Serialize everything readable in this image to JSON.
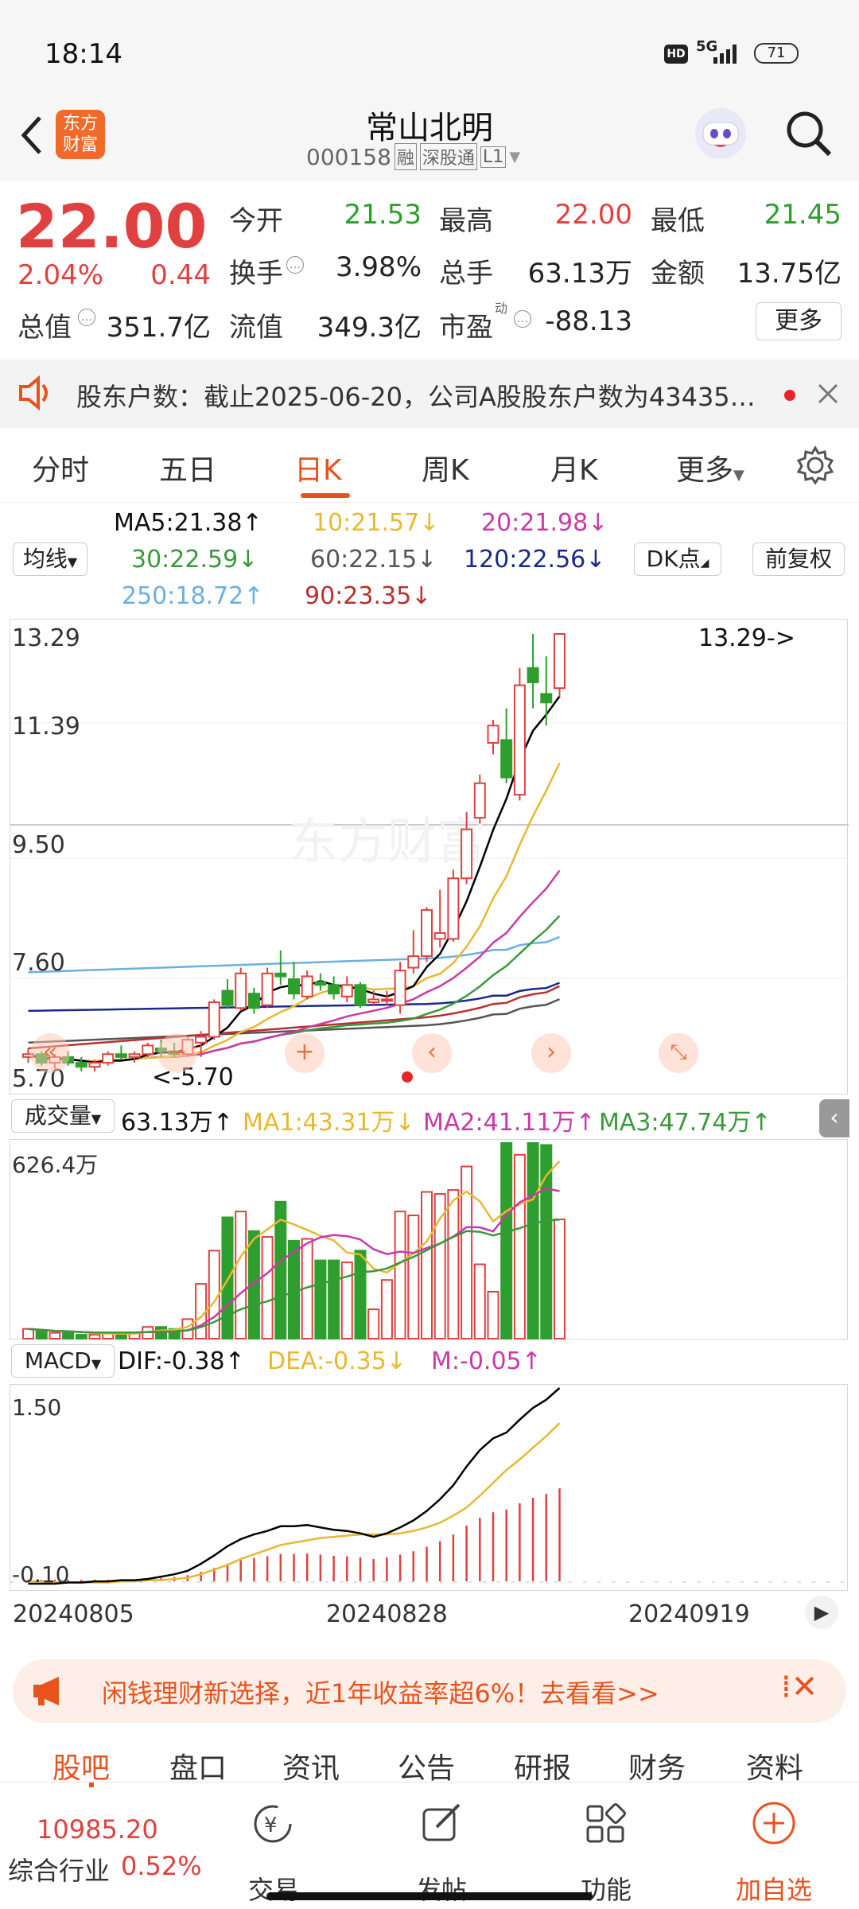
{
  "status": {
    "time": "18:14",
    "battery": "71",
    "network": "5G",
    "hd": "HD"
  },
  "nav": {
    "logo_line1": "东方",
    "logo_line2": "财富",
    "title": "常山北明",
    "code": "000158",
    "tag1": "融",
    "tag2": "深股通",
    "tag3": "L1"
  },
  "quote": {
    "price": "22.00",
    "pct": "2.04%",
    "change": "0.44",
    "rows": [
      [
        {
          "label": "今开",
          "value": "21.53",
          "color": "green"
        },
        {
          "label": "最高",
          "value": "22.00",
          "color": "red"
        },
        {
          "label": "最低",
          "value": "21.45",
          "color": "green"
        }
      ],
      [
        {
          "label": "换手",
          "value": "3.98%",
          "color": "dark"
        },
        {
          "label": "总手",
          "value": "63.13万",
          "color": "dark"
        },
        {
          "label": "金额",
          "value": "13.75亿",
          "color": "dark"
        }
      ],
      [
        {
          "label": "总值",
          "value": "351.7亿",
          "color": "dark"
        },
        {
          "label": "流值",
          "value": "349.3亿",
          "color": "dark"
        },
        {
          "label": "市盈",
          "value": "-88.13",
          "color": "dark"
        }
      ]
    ],
    "pe_sup": "动",
    "more_label": "更多"
  },
  "notice": {
    "text": "股东户数：截止2025-06-20，公司A股股东户数为43435…"
  },
  "tabs": [
    {
      "label": "分时",
      "active": false
    },
    {
      "label": "五日",
      "active": false
    },
    {
      "label": "日K",
      "active": true
    },
    {
      "label": "周K",
      "active": false
    },
    {
      "label": "月K",
      "active": false
    },
    {
      "label": "更多",
      "active": false
    }
  ],
  "ma_panel": {
    "selector": "均线",
    "ma5": "MA5:21.38↑",
    "ma10": "10:21.57↓",
    "ma20": "20:21.98↓",
    "ma30": "30:22.59↓",
    "ma60": "60:22.15↓",
    "ma120": "120:22.56↓",
    "ma250": "250:18.72↑",
    "ma90": "90:23.35↓",
    "dk_label": "DK点",
    "adjust_label": "前复权"
  },
  "colors": {
    "up": "#e04040",
    "down": "#2e9e2e",
    "ma5": "#000000",
    "ma10": "#e8b830",
    "ma20": "#c83aa8",
    "ma30": "#3a9a3a",
    "ma60": "#555555",
    "ma120": "#1a2a8a",
    "ma250": "#6ab0e0",
    "ma90": "#b83030"
  },
  "price_chart": {
    "y_labels": [
      "13.29",
      "11.39",
      "9.50",
      "7.60",
      "5.70"
    ],
    "high_marker": "13.29->",
    "low_marker": "<-5.70",
    "watermark": "东方财富"
  },
  "volume_panel": {
    "selector": "成交量",
    "value": "63.13万↑",
    "ma1": "MA1:43.31万↓",
    "ma2": "MA2:41.11万↑",
    "ma3": "MA3:47.74万↑",
    "max_label": "626.4万"
  },
  "macd_panel": {
    "selector": "MACD",
    "dif": "DIF:-0.38↑",
    "dea": "DEA:-0.35↓",
    "m": "M:-0.05↑",
    "top_label": "1.50",
    "bottom_label": "-0.10"
  },
  "dates": [
    "20240805",
    "20240828",
    "20240919"
  ],
  "ad": {
    "text": "闲钱理财新选择，近1年收益率超6%！去看看>>"
  },
  "bottom_tabs": [
    "股吧",
    "盘口",
    "资讯",
    "公告",
    "研报",
    "财务",
    "资料"
  ],
  "footer": {
    "index_value": "10985.20",
    "index_label": "综合行业",
    "index_pct": "0.52%",
    "items": [
      {
        "label": "交易"
      },
      {
        "label": "发帖"
      },
      {
        "label": "功能"
      },
      {
        "label": "加自选"
      }
    ]
  },
  "candles": [
    [
      5.95,
      6.1,
      5.85,
      6.0
    ],
    [
      6.0,
      6.05,
      5.8,
      5.85
    ],
    [
      5.85,
      6.0,
      5.75,
      5.95
    ],
    [
      5.95,
      6.05,
      5.8,
      5.85
    ],
    [
      5.85,
      5.95,
      5.7,
      5.78
    ],
    [
      5.78,
      5.9,
      5.7,
      5.85
    ],
    [
      5.85,
      6.05,
      5.8,
      6.0
    ],
    [
      6.0,
      6.15,
      5.9,
      5.95
    ],
    [
      5.95,
      6.05,
      5.85,
      6.0
    ],
    [
      6.0,
      6.2,
      5.95,
      6.15
    ],
    [
      6.1,
      6.25,
      5.95,
      6.05
    ],
    [
      6.05,
      6.2,
      5.95,
      6.0
    ],
    [
      6.0,
      6.3,
      5.95,
      6.25
    ],
    [
      6.2,
      6.4,
      5.95,
      6.3
    ],
    [
      6.3,
      6.95,
      6.25,
      6.9
    ],
    [
      7.1,
      7.3,
      6.8,
      6.85
    ],
    [
      6.8,
      7.5,
      6.75,
      7.4
    ],
    [
      7.05,
      7.15,
      6.7,
      6.8
    ],
    [
      6.85,
      7.5,
      6.8,
      7.4
    ],
    [
      7.4,
      7.8,
      7.2,
      7.35
    ],
    [
      7.3,
      7.6,
      6.95,
      7.05
    ],
    [
      7.0,
      7.45,
      6.95,
      7.35
    ],
    [
      7.25,
      7.4,
      7.1,
      7.2
    ],
    [
      7.2,
      7.35,
      6.95,
      7.05
    ],
    [
      7.0,
      7.35,
      6.9,
      7.2
    ],
    [
      7.2,
      7.25,
      6.8,
      6.85
    ],
    [
      6.9,
      7.1,
      6.85,
      6.95
    ],
    [
      6.95,
      7.1,
      6.85,
      6.95
    ],
    [
      6.85,
      7.6,
      6.7,
      7.45
    ],
    [
      7.5,
      8.15,
      7.4,
      7.7
    ],
    [
      7.7,
      8.55,
      7.6,
      8.5
    ],
    [
      8.0,
      8.85,
      7.85,
      8.1
    ],
    [
      8.0,
      9.2,
      7.95,
      9.05
    ],
    [
      9.05,
      10.2,
      8.95,
      9.9
    ],
    [
      10.1,
      10.85,
      10.0,
      10.7
    ],
    [
      11.4,
      11.8,
      11.2,
      11.7
    ],
    [
      11.45,
      12.0,
      10.7,
      10.8
    ],
    [
      10.5,
      12.7,
      10.4,
      12.4
    ],
    [
      12.7,
      13.29,
      12.0,
      12.45
    ],
    [
      12.25,
      12.9,
      11.7,
      12.1
    ],
    [
      12.35,
      13.2,
      12.2,
      13.29
    ]
  ],
  "volumes": [
    0.05,
    0.04,
    0.03,
    0.03,
    0.02,
    0.02,
    0.03,
    0.03,
    0.03,
    0.06,
    0.06,
    0.05,
    0.1,
    0.28,
    0.45,
    0.62,
    0.65,
    0.55,
    0.52,
    0.7,
    0.5,
    0.51,
    0.4,
    0.4,
    0.39,
    0.45,
    0.15,
    0.3,
    0.65,
    0.63,
    0.75,
    0.74,
    0.76,
    0.88,
    0.38,
    0.24,
    1.0,
    0.94,
    1.0,
    0.99,
    0.61
  ],
  "dif": [
    -0.12,
    -0.12,
    -0.12,
    -0.11,
    -0.11,
    -0.1,
    -0.1,
    -0.09,
    -0.09,
    -0.08,
    -0.06,
    -0.04,
    -0.01,
    0.05,
    0.12,
    0.2,
    0.26,
    0.3,
    0.33,
    0.37,
    0.37,
    0.38,
    0.36,
    0.34,
    0.33,
    0.31,
    0.28,
    0.31,
    0.36,
    0.42,
    0.5,
    0.6,
    0.72,
    0.88,
    1.02,
    1.12,
    1.17,
    1.28,
    1.38,
    1.45,
    1.55
  ],
  "dea": [
    -0.1,
    -0.1,
    -0.11,
    -0.11,
    -0.11,
    -0.11,
    -0.11,
    -0.1,
    -0.1,
    -0.09,
    -0.09,
    -0.08,
    -0.07,
    -0.04,
    0.0,
    0.04,
    0.09,
    0.13,
    0.17,
    0.21,
    0.23,
    0.25,
    0.27,
    0.28,
    0.29,
    0.3,
    0.3,
    0.3,
    0.31,
    0.33,
    0.36,
    0.4,
    0.46,
    0.53,
    0.63,
    0.74,
    0.85,
    0.94,
    1.04,
    1.14,
    1.25
  ]
}
